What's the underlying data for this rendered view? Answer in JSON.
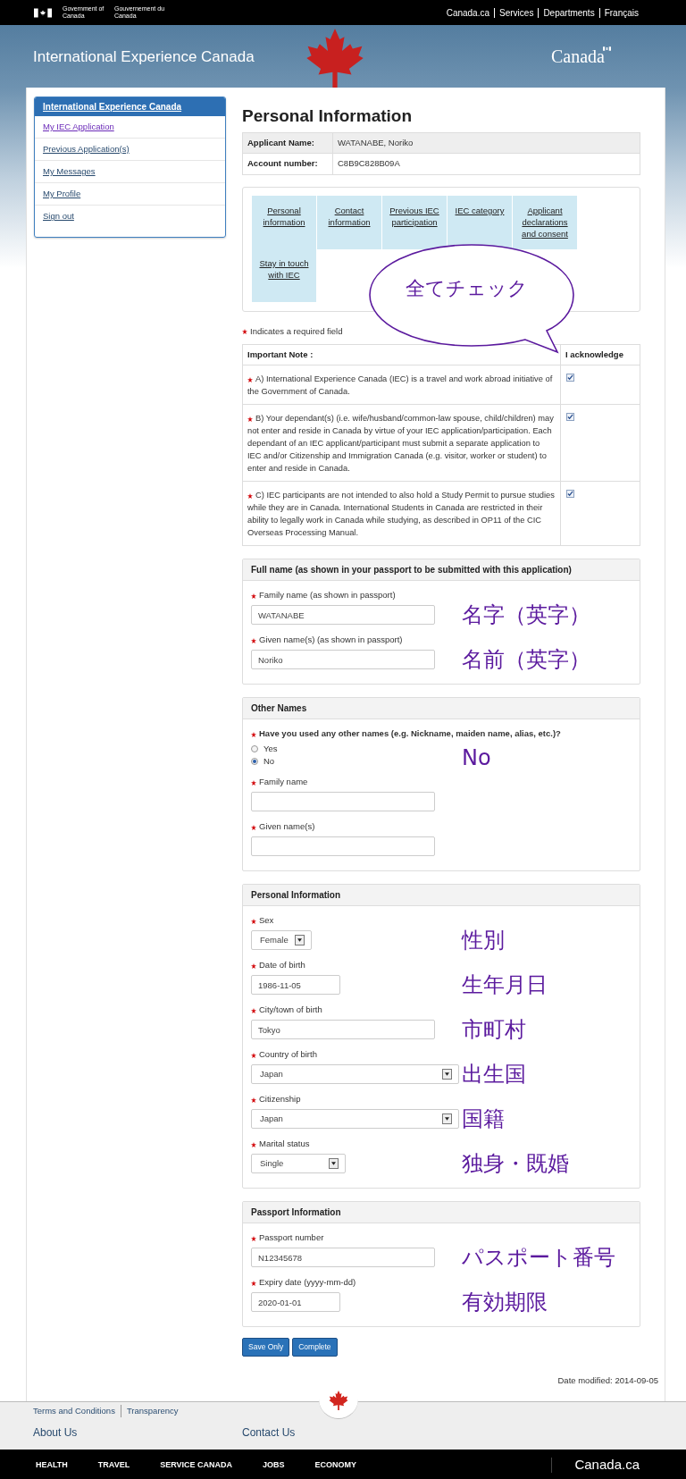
{
  "gov_bar": {
    "name_en": "Government of Canada",
    "name_fr": "Gouvernement du Canada",
    "links": [
      "Canada.ca",
      "Services",
      "Departments",
      "Français"
    ]
  },
  "banner": {
    "title": "International Experience Canada",
    "wordmark": "Canada"
  },
  "sidebar": {
    "heading": "International Experience Canada",
    "items": [
      {
        "label": "My IEC Application",
        "visited": true
      },
      {
        "label": "Previous Application(s)",
        "visited": false
      },
      {
        "label": "My Messages",
        "visited": false
      },
      {
        "label": "My Profile",
        "visited": false
      },
      {
        "label": "Sign out",
        "visited": false
      }
    ]
  },
  "page_title": "Personal Information",
  "applicant": [
    {
      "label": "Applicant Name:",
      "value": "WATANABE, Noriko"
    },
    {
      "label": "Account number:",
      "value": "C8B9C828B09A"
    }
  ],
  "steps": [
    "Personal information",
    "Contact information",
    "Previous IEC participation",
    "IEC category",
    "Applicant declarations and consent",
    "Stay in touch with IEC"
  ],
  "callout": "全てチェック",
  "required_note": "Indicates a required field",
  "notes_table": {
    "columns": [
      "Important Note :",
      "I acknowledge"
    ],
    "rows": [
      {
        "text": "A) International Experience Canada (IEC) is a travel and work abroad initiative of the Government of Canada.",
        "required": true,
        "checked": true
      },
      {
        "text": "B) Your dependant(s) (i.e. wife/husband/common-law spouse, child/children) may not enter and reside in Canada by virtue of your IEC application/participation. Each dependant of an IEC applicant/participant must submit a separate application to IEC and/or Citizenship and Immigration Canada (e.g. visitor, worker or student) to enter and reside in Canada.",
        "required": true,
        "checked": true
      },
      {
        "text": "C) IEC participants are not intended to also hold a Study Permit to pursue studies while they are in Canada. International Students in Canada are restricted in their ability to legally work in Canada while studying, as described in OP11 of the CIC Overseas Processing Manual.",
        "required": true,
        "checked": true
      }
    ]
  },
  "sections": [
    {
      "title": "Full name (as shown in your passport to be submitted with this application)",
      "fields": [
        {
          "kind": "text",
          "label": "Family name (as shown in passport)",
          "required": true,
          "value": "WATANABE",
          "note": "名字（英字）"
        },
        {
          "kind": "text",
          "label": "Given name(s) (as shown in passport)",
          "required": true,
          "value": "Noriko",
          "note": "名前（英字）"
        }
      ]
    },
    {
      "title": "Other Names",
      "fields": [
        {
          "kind": "radio",
          "label": "Have you used any other names (e.g. Nickname, maiden name, alias, etc.)?",
          "required": true,
          "options": [
            {
              "label": "Yes",
              "selected": false
            },
            {
              "label": "No",
              "selected": true
            }
          ],
          "note": "No"
        },
        {
          "kind": "text",
          "label": "Family name",
          "required": true
        },
        {
          "kind": "text",
          "label": "Given name(s)",
          "required": true
        }
      ]
    },
    {
      "title": "Personal Information",
      "fields": [
        {
          "kind": "select",
          "label": "Sex",
          "required": true,
          "value": "Female",
          "note": "性別"
        },
        {
          "kind": "date",
          "label": "Date of birth",
          "required": true,
          "value": "1986-11-05",
          "note": "生年月日"
        },
        {
          "kind": "text",
          "label": "City/town of birth",
          "required": true,
          "value": "Tokyo",
          "note": "市町村"
        },
        {
          "kind": "select",
          "label": "Country of birth",
          "required": true,
          "value": "Japan",
          "note": "出生国"
        },
        {
          "kind": "select",
          "label": "Citizenship",
          "required": true,
          "value": "Japan",
          "note": "国籍"
        },
        {
          "kind": "select",
          "label": "Marital status",
          "required": true,
          "value": "Single",
          "note": "独身・既婚"
        }
      ]
    },
    {
      "title": "Passport Information",
      "fields": [
        {
          "kind": "text",
          "label": "Passport number",
          "required": true,
          "value": "N12345678",
          "note": "パスポート番号"
        },
        {
          "kind": "date",
          "label": "Expiry date (yyyy-mm-dd)",
          "required": true,
          "value": "2020-01-01",
          "note": "有効期限"
        }
      ]
    }
  ],
  "buttons": [
    "Save Only",
    "Complete"
  ],
  "date_modified": "Date modified: 2014-09-05",
  "footer": {
    "links": [
      "Terms and Conditions",
      "Transparency"
    ],
    "columns": [
      "About Us",
      "Contact Us"
    ],
    "nav": [
      "HEALTH",
      "TRAVEL",
      "SERVICE CANADA",
      "JOBS",
      "ECONOMY"
    ],
    "brand": "Canada.ca"
  }
}
